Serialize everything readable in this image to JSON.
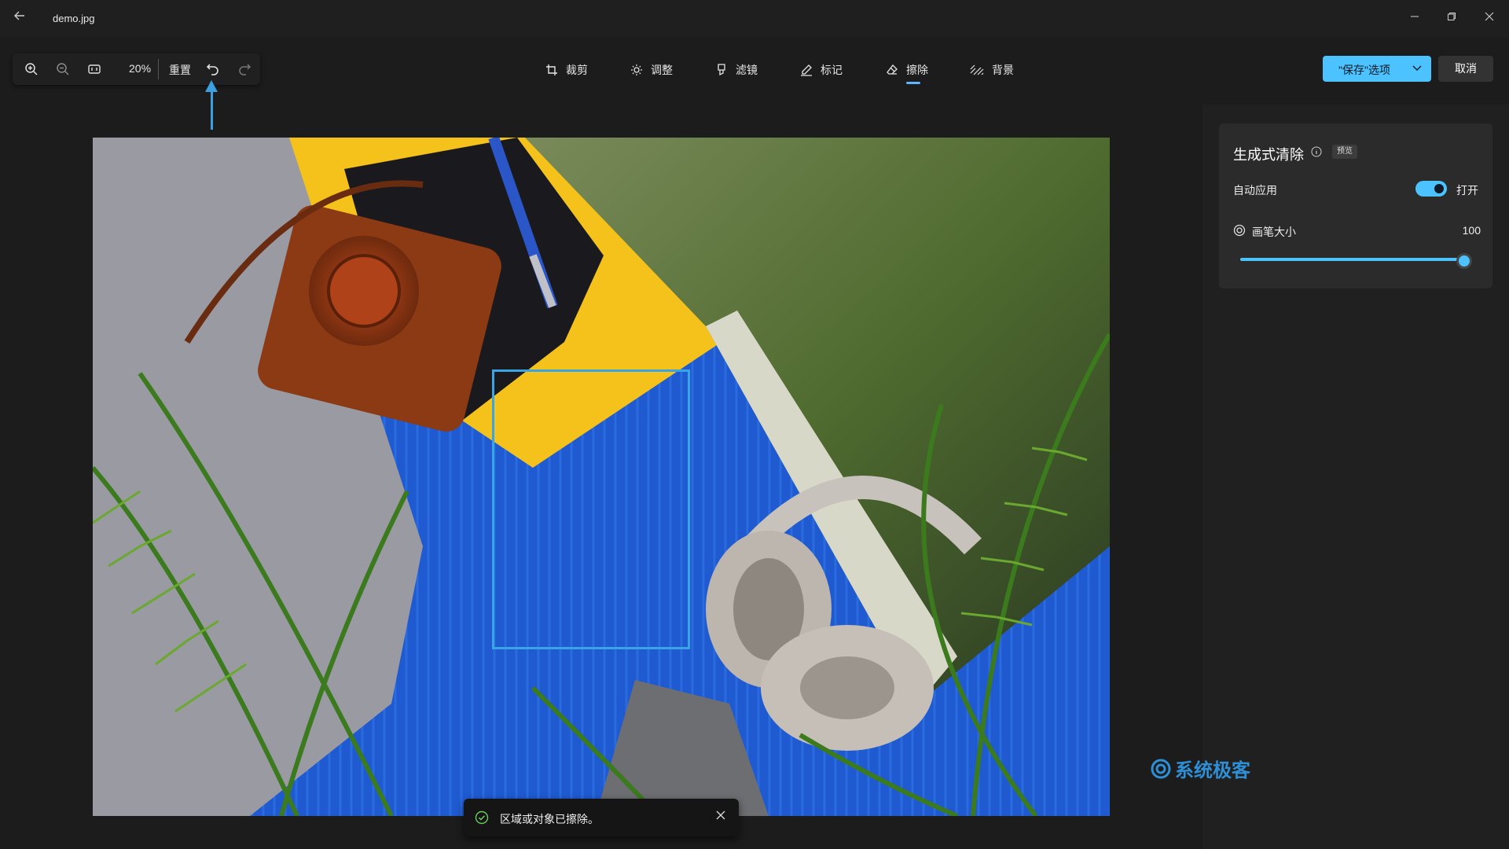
{
  "window": {
    "filename": "demo.jpg",
    "back_icon": "back-arrow-icon",
    "controls": [
      "minimize-icon",
      "restore-icon",
      "close-icon"
    ]
  },
  "toolbar": {
    "zoom_in_icon": "zoom-in-icon",
    "zoom_out_icon": "zoom-out-icon",
    "fit_icon": "actual-size-icon",
    "zoom_level": "20%",
    "reset_label": "重置",
    "undo_icon": "undo-icon",
    "redo_icon": "redo-icon"
  },
  "tabs": [
    {
      "label": "裁剪",
      "icon": "crop-icon",
      "active": false
    },
    {
      "label": "调整",
      "icon": "brightness-icon",
      "active": false
    },
    {
      "label": "滤镜",
      "icon": "filter-icon",
      "active": false
    },
    {
      "label": "标记",
      "icon": "pen-icon",
      "active": false
    },
    {
      "label": "擦除",
      "icon": "eraser-icon",
      "active": true
    },
    {
      "label": "背景",
      "icon": "background-icon",
      "active": false
    }
  ],
  "actions": {
    "save_label": "\"保存\"选项",
    "cancel_label": "取消"
  },
  "panel": {
    "title": "生成式清除",
    "badge": "预览",
    "auto_apply_label": "自动应用",
    "auto_apply_state": "打开",
    "auto_apply_on": true,
    "brush_size_label": "画笔大小",
    "brush_size_value": "100",
    "brush_size_fraction": 1.0
  },
  "toast": {
    "message": "区域或对象已擦除。"
  },
  "watermark": {
    "text": "系统极客"
  },
  "colors": {
    "accent": "#4cc2ff",
    "selection": "#3aa5e4",
    "background": "#1c1c1c"
  }
}
